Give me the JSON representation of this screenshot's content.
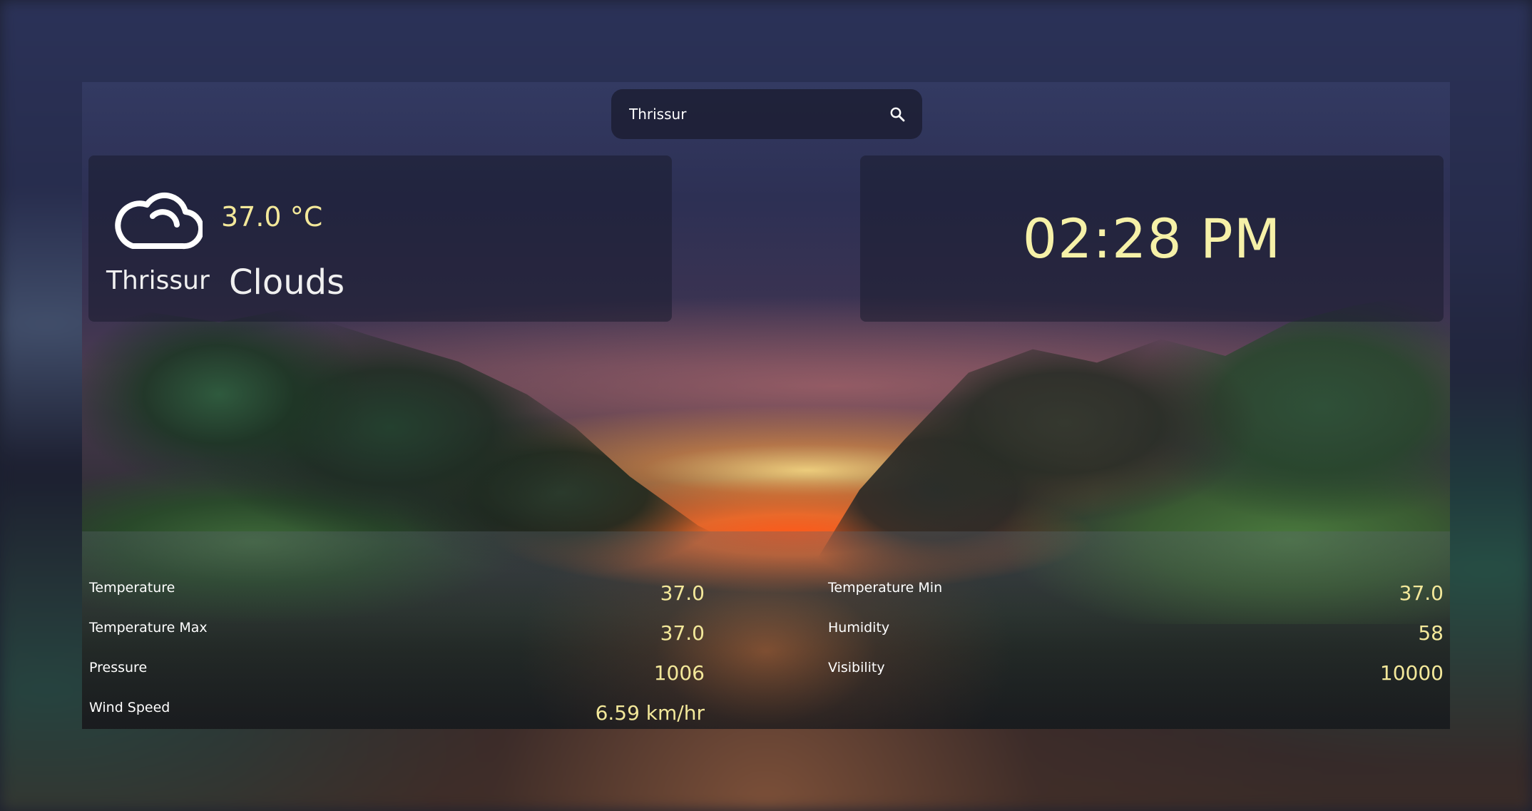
{
  "search": {
    "value": "Thrissur",
    "icon": "search-icon"
  },
  "weather": {
    "icon": "cloud-icon",
    "temperature": "37.0 °C",
    "city": "Thrissur",
    "condition": "Clouds"
  },
  "clock": {
    "time": "02:28 PM"
  },
  "stats": {
    "left": [
      {
        "label": "Temperature",
        "value": "37.0"
      },
      {
        "label": "Temperature Max",
        "value": "37.0"
      },
      {
        "label": "Pressure",
        "value": "1006"
      },
      {
        "label": "Wind Speed",
        "value": "6.59 km/hr"
      }
    ],
    "right": [
      {
        "label": "Temperature Min",
        "value": "37.0"
      },
      {
        "label": "Humidity",
        "value": "58"
      },
      {
        "label": "Visibility",
        "value": "10000"
      }
    ]
  },
  "colors": {
    "accent": "#f3e89a",
    "panel": "#1c1f34"
  }
}
